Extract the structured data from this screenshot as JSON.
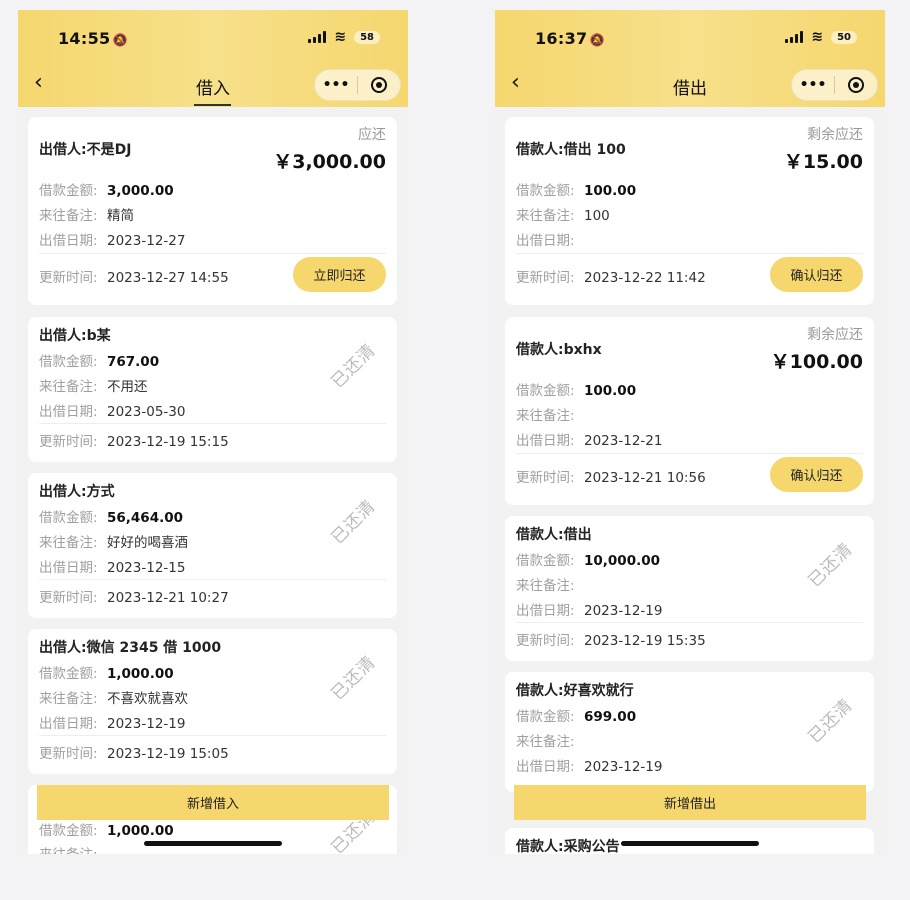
{
  "left": {
    "status": {
      "time": "14:55",
      "battery": "58"
    },
    "nav": {
      "back": "‹",
      "title": "借入",
      "more": "•••"
    },
    "cards": [
      {
        "title": "出借人:不是DJ",
        "due_label": "应还",
        "amount": "￥3,000.00",
        "amount_label": "借款金额:",
        "amount_val": "3,000.00",
        "note_label": "来往备注:",
        "note_val": "精简",
        "date_label": "出借日期:",
        "date_val": "2023-12-27",
        "updated_label": "更新时间:",
        "updated_val": "2023-12-27 14:55",
        "button": "立即归还"
      },
      {
        "title": "出借人:b某",
        "stamp": "已还清",
        "amount_label": "借款金额:",
        "amount_val": "767.00",
        "note_label": "来往备注:",
        "note_val": "不用还",
        "date_label": "出借日期:",
        "date_val": "2023-05-30",
        "updated_label": "更新时间:",
        "updated_val": "2023-12-19 15:15"
      },
      {
        "title": "出借人:方式",
        "stamp": "已还清",
        "amount_label": "借款金额:",
        "amount_val": "56,464.00",
        "note_label": "来往备注:",
        "note_val": "好好的喝喜酒",
        "date_label": "出借日期:",
        "date_val": "2023-12-15",
        "updated_label": "更新时间:",
        "updated_val": "2023-12-21 10:27"
      },
      {
        "title": "出借人:微信 2345 借 1000",
        "stamp": "已还清",
        "amount_label": "借款金额:",
        "amount_val": "1,000.00",
        "note_label": "来往备注:",
        "note_val": "不喜欢就喜欢",
        "date_label": "出借日期:",
        "date_val": "2023-12-19",
        "updated_label": "更新时间:",
        "updated_val": "2023-12-19 15:05"
      },
      {
        "stamp": "已还清",
        "amount_label": "借款金额:",
        "amount_val": "1,000.00",
        "note_label": "来往备注:"
      }
    ],
    "add_button": "新增借入"
  },
  "right": {
    "status": {
      "time": "16:37",
      "battery": "50"
    },
    "nav": {
      "back": "‹",
      "title": "借出",
      "more": "•••"
    },
    "cards": [
      {
        "title": "借款人:借出 100",
        "due_label": "剩余应还",
        "amount": "￥15.00",
        "amount_label": "借款金额:",
        "amount_val": "100.00",
        "note_label": "来往备注:",
        "note_val": "100",
        "date_label": "出借日期:",
        "date_val": "",
        "updated_label": "更新时间:",
        "updated_val": "2023-12-22 11:42",
        "button": "确认归还"
      },
      {
        "title": "借款人:bxhx",
        "due_label": "剩余应还",
        "amount": "￥100.00",
        "amount_label": "借款金额:",
        "amount_val": "100.00",
        "note_label": "来往备注:",
        "note_val": "",
        "date_label": "出借日期:",
        "date_val": "2023-12-21",
        "updated_label": "更新时间:",
        "updated_val": "2023-12-21 10:56",
        "button": "确认归还"
      },
      {
        "title": "借款人:借出",
        "stamp": "已还清",
        "amount_label": "借款金额:",
        "amount_val": "10,000.00",
        "note_label": "来往备注:",
        "note_val": "",
        "date_label": "出借日期:",
        "date_val": "2023-12-19",
        "updated_label": "更新时间:",
        "updated_val": "2023-12-19 15:35"
      },
      {
        "title": "借款人:好喜欢就行",
        "stamp": "已还清",
        "amount_label": "借款金额:",
        "amount_val": "699.00",
        "note_label": "来往备注:",
        "note_val": "",
        "date_label": "出借日期:",
        "date_val": "2023-12-19"
      },
      {
        "title": "借款人:采购公告"
      }
    ],
    "add_button": "新增借出"
  }
}
